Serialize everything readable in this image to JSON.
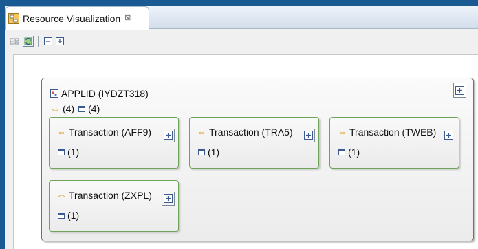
{
  "tab": {
    "title": "Resource Visualization",
    "close_glyph": "⊠",
    "icon": "resource-visualization-icon"
  },
  "toolbar": {
    "icons": [
      "layout-icon",
      "refresh-diagram-icon",
      "collapse-all-icon",
      "expand-all-icon"
    ]
  },
  "app_node": {
    "title": "APPLID (IYDZT318)",
    "connections_count": "(4)",
    "windows_count": "(4)"
  },
  "transactions": [
    {
      "title": "Transaction (AFF9)",
      "count": "(1)"
    },
    {
      "title": "Transaction (TRA5)",
      "count": "(1)"
    },
    {
      "title": "Transaction (TWEB)",
      "count": "(1)"
    },
    {
      "title": "Transaction (ZXPL)",
      "count": "(1)"
    }
  ],
  "colors": {
    "frame": "#1a5a93",
    "app_border": "#8a6a55",
    "tx_border": "#6ea45a",
    "arrow": "#e0a32a",
    "window_icon": "#3c5a90"
  }
}
